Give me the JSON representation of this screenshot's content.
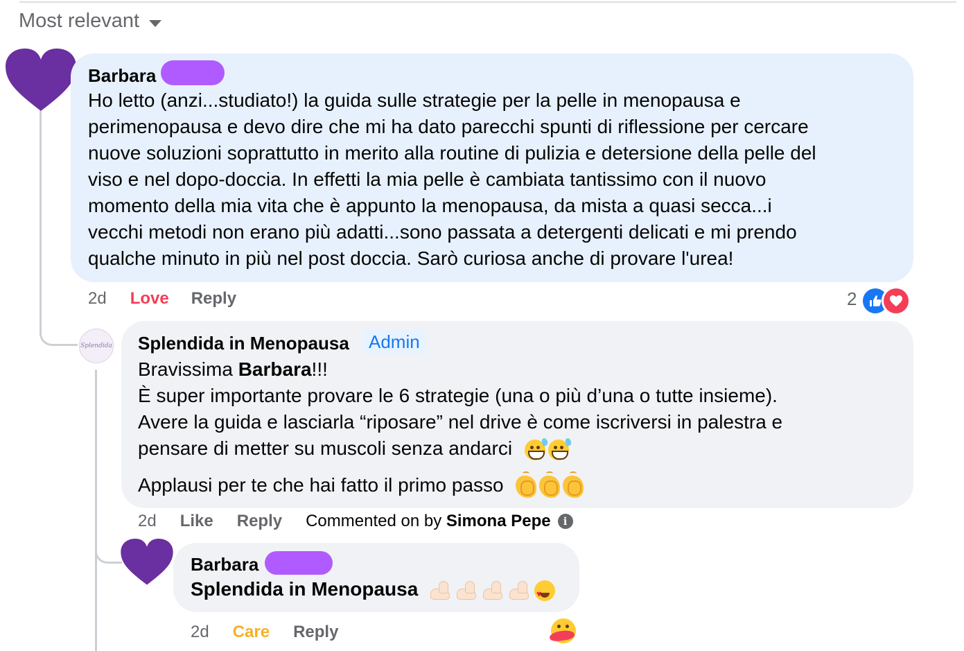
{
  "sort": {
    "label": "Most relevant"
  },
  "comments": [
    {
      "author": "Barbara",
      "lines": [
        "Ho letto (anzi...studiato!) la guida sulle strategie per la pelle in menopausa e",
        "perimenopausa e devo dire che mi ha dato parecchi spunti di riflessione per cercare",
        "nuove soluzioni soprattutto in merito alla routine di pulizia e detersione della pelle del",
        "viso e nel dopo-doccia. In effetti la mia pelle è cambiata tantissimo con il nuovo",
        "momento della mia vita che è appunto la menopausa, da mista a quasi secca...i",
        "vecchi metodi non erano più adatti...sono passata a detergenti delicati e mi prendo",
        "qualche minuto in più nel post doccia. Sarò curiosa anche di provare l'urea!"
      ],
      "time": "2d",
      "reaction_label": "Love",
      "reply_label": "Reply",
      "reaction_count": "2"
    },
    {
      "author": "Splendida in Menopausa",
      "badge": "Admin",
      "greeting_prefix": "Bravissima ",
      "greeting_name": "Barbara",
      "greeting_suffix": "!!!",
      "lines": [
        "È super importante provare le 6 strategie (una o più d’una o tutte insieme).",
        "Avere la guida e lasciarla “riposare” nel drive è come iscriversi in palestra e",
        "pensare di metter su muscoli senza andarci"
      ],
      "closing": "Applausi per te che hai fatto il primo passo",
      "time": "2d",
      "like_label": "Like",
      "reply_label": "Reply",
      "commented_prefix": "Commented on by ",
      "commented_by": "Simona Pepe",
      "avatar_text": "Splendida"
    },
    {
      "author": "Barbara",
      "text": "Splendida in Menopausa",
      "time": "2d",
      "reaction_label": "Care",
      "reply_label": "Reply"
    }
  ],
  "colors": {
    "love": "#f33e58",
    "care": "#f7b125",
    "admin": "#1877f2",
    "heart_avatar": "#6a2fa0",
    "redaction": "#b05bff"
  }
}
